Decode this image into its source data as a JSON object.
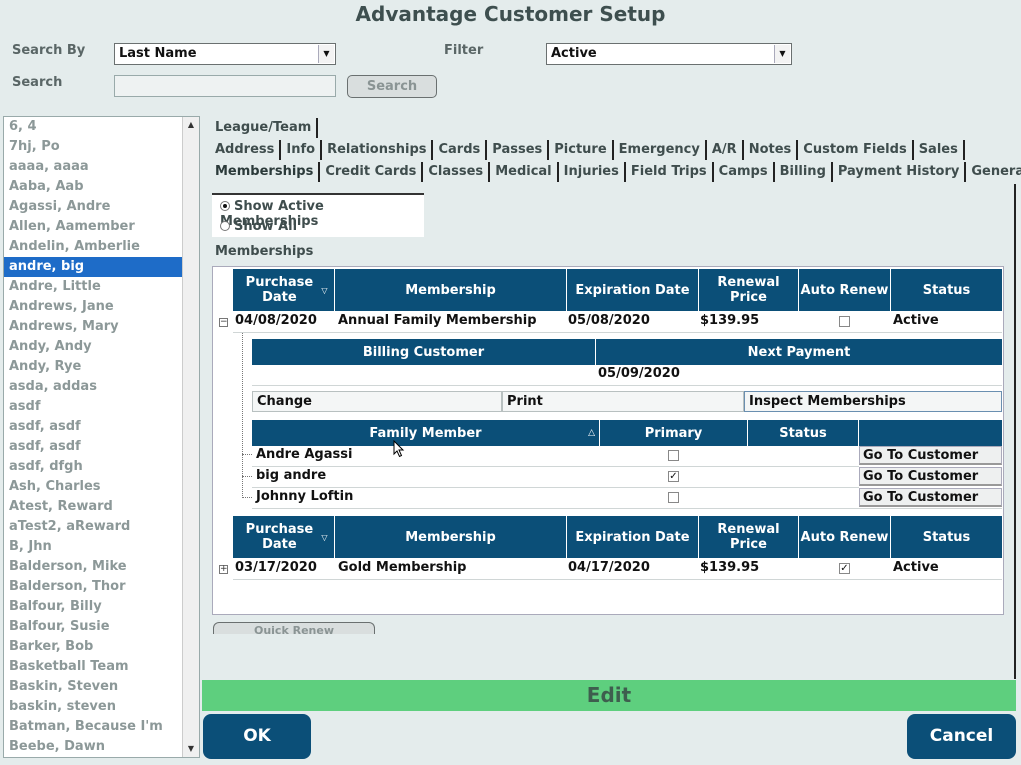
{
  "window": {
    "title": "Advantage Customer Setup"
  },
  "search": {
    "search_by_label": "Search By",
    "search_by_value": "Last Name",
    "filter_label": "Filter",
    "filter_value": "Active",
    "search_label": "Search",
    "search_value": "",
    "search_button": "Search"
  },
  "customers": [
    "6, 4",
    "7hj, Po",
    "aaaa, aaaa",
    "Aaba, Aab",
    "Agassi, Andre",
    "Allen, Aamember",
    "Andelin, Amberlie",
    "andre, big",
    "Andre, Little",
    "Andrews, Jane",
    "Andrews, Mary",
    "Andy, Andy",
    "Andy, Rye",
    "asda, addas",
    "asdf",
    "asdf, asdf",
    "asdf, asdf",
    "asdf, dfgh",
    "Ash, Charles",
    "Atest, Reward",
    "aTest2, aReward",
    "B, Jhn",
    "Balderson, Mike",
    "Balderson, Thor",
    "Balfour, Billy",
    "Balfour, Susie",
    "Barker, Bob",
    "Basketball Team",
    "Baskin, Steven",
    "baskin, steven",
    "Batman, Because I'm",
    "Beebe, Dawn"
  ],
  "selected_customer": "andre, big",
  "tabs": {
    "row1": [
      "League/Team"
    ],
    "row2": [
      "Address",
      "Info",
      "Relationships",
      "Cards",
      "Passes",
      "Picture",
      "Emergency",
      "A/R",
      "Notes",
      "Custom Fields",
      "Sales"
    ],
    "row3": [
      "Memberships",
      "Credit Cards",
      "Classes",
      "Medical",
      "Injuries",
      "Field Trips",
      "Camps",
      "Billing",
      "Payment History",
      "General"
    ],
    "active": "Memberships"
  },
  "filter_radios": {
    "active_label": "Show Active Memberships",
    "all_label": "Show All",
    "selected": "active"
  },
  "memberships_label": "Memberships",
  "membership_columns": [
    "Purchase Date",
    "Membership",
    "Expiration Date",
    "Renewal Price",
    "Auto Renew",
    "Status"
  ],
  "memberships": [
    {
      "purchase_date": "04/08/2020",
      "membership": "Annual Family Membership",
      "expiration_date": "05/08/2020",
      "renewal_price": "$139.95",
      "auto_renew": false,
      "status": "Active",
      "expanded": true
    },
    {
      "purchase_date": "03/17/2020",
      "membership": "Gold Membership",
      "expiration_date": "04/17/2020",
      "renewal_price": "$139.95",
      "auto_renew": true,
      "status": "Active",
      "expanded": false
    }
  ],
  "detail": {
    "billing_columns": [
      "Billing Customer",
      "Next Payment"
    ],
    "billing_customer": "",
    "next_payment": "05/09/2020",
    "actions": [
      "Change",
      "Print",
      "Inspect Memberships"
    ],
    "family_columns": [
      "Family Member",
      "Primary",
      "Status",
      ""
    ],
    "family": [
      {
        "name": "Andre Agassi",
        "primary": false,
        "status": "",
        "action": "Go To Customer"
      },
      {
        "name": "big andre",
        "primary": true,
        "status": "",
        "action": "Go To Customer"
      },
      {
        "name": "Johnny Loftin",
        "primary": false,
        "status": "",
        "action": "Go To Customer"
      }
    ]
  },
  "quick_renew": "Quick Renew",
  "mode_label": "Edit",
  "ok_button": "OK",
  "cancel_button": "Cancel",
  "icons": {
    "dropdown": "chevron-down-icon",
    "sort_desc": "sort-descending-icon",
    "sort_asc": "sort-ascending-icon",
    "expand": "plus-box-icon",
    "collapse": "minus-box-icon"
  },
  "colors": {
    "header": "#0b4f78",
    "edit_bar": "#5ecf7e",
    "selected": "#1e6cc8"
  }
}
